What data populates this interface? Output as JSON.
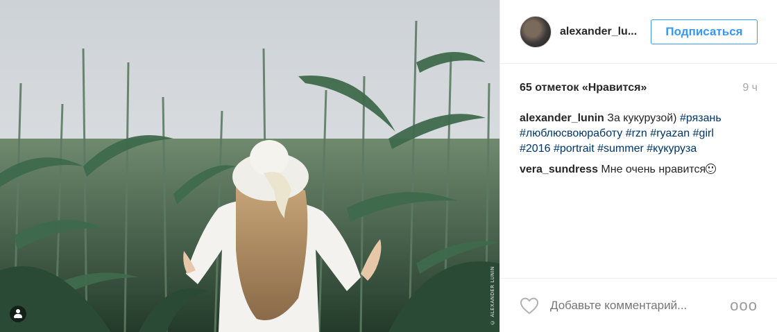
{
  "post": {
    "username": "alexander_lu...",
    "follow_label": "Подписаться",
    "likes": "65 отметок «Нравится»",
    "time_ago": "9 ч",
    "caption": {
      "author": "alexander_lunin",
      "text": "За кукурузой)",
      "tags": [
        "#рязань",
        "#люблюсвоюработу",
        "#rzn",
        "#ryazan",
        "#girl",
        "#2016",
        "#portrait",
        "#summer",
        "#кукуруза"
      ]
    },
    "comments": [
      {
        "author": "vera_sundress",
        "text": "Мне очень нравится"
      }
    ],
    "comment_placeholder": "Добавьте комментарий...",
    "more_label": "ooo",
    "watermark": "© ALEXANDER LUNIN"
  },
  "colors": {
    "accent": "#3897f0",
    "hashtag": "#003569",
    "muted": "#999999"
  },
  "icons": {
    "heart": "heart-outline-icon",
    "tag": "user-tag-icon",
    "more": "more-dots-icon",
    "emoji": "smiling-face-emoji"
  }
}
